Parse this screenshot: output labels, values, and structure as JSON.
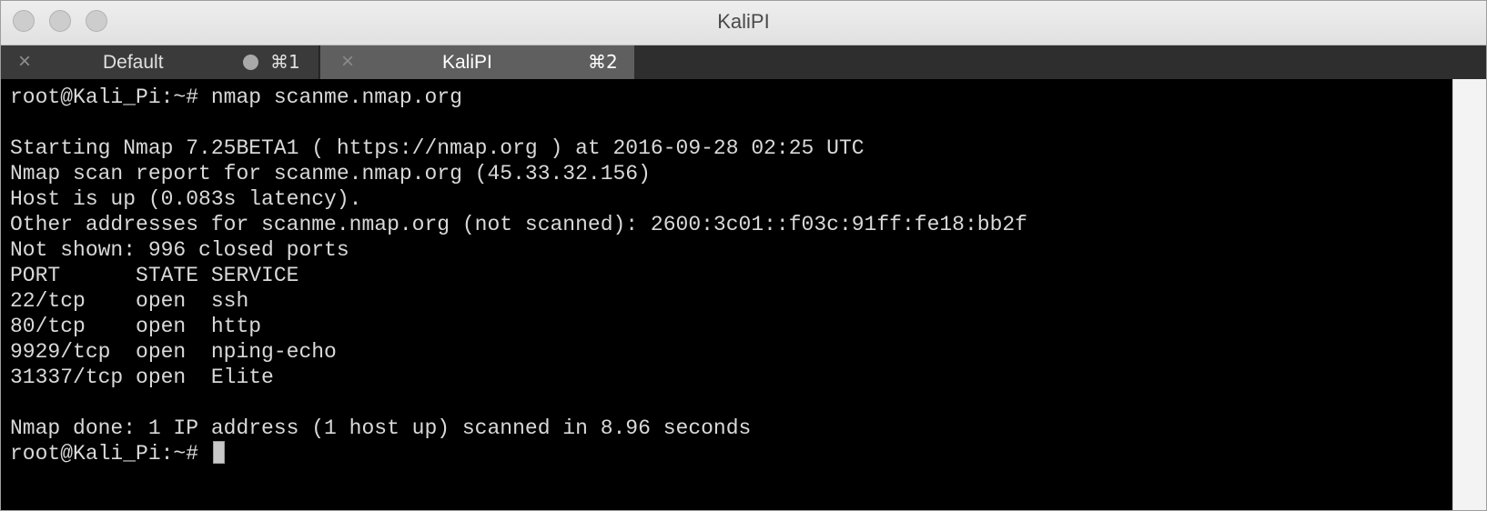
{
  "window": {
    "title": "KaliPI"
  },
  "tabs": [
    {
      "title": "Default",
      "shortcut": "⌘1",
      "active": false,
      "activity": true
    },
    {
      "title": "KaliPI",
      "shortcut": "⌘2",
      "active": true,
      "activity": false
    }
  ],
  "terminal": {
    "lines": [
      "root@Kali_Pi:~# nmap scanme.nmap.org",
      "",
      "Starting Nmap 7.25BETA1 ( https://nmap.org ) at 2016-09-28 02:25 UTC",
      "Nmap scan report for scanme.nmap.org (45.33.32.156)",
      "Host is up (0.083s latency).",
      "Other addresses for scanme.nmap.org (not scanned): 2600:3c01::f03c:91ff:fe18:bb2f",
      "Not shown: 996 closed ports",
      "PORT      STATE SERVICE",
      "22/tcp    open  ssh",
      "80/tcp    open  http",
      "9929/tcp  open  nping-echo",
      "31337/tcp open  Elite",
      "",
      "Nmap done: 1 IP address (1 host up) scanned in 8.96 seconds"
    ],
    "prompt": "root@Kali_Pi:~# "
  },
  "colors": {
    "terminal_background": "#000000",
    "terminal_foreground": "#d9d9d9",
    "tabbar_background": "#2e2e2e",
    "active_tab_background": "#5f5f5f",
    "titlebar_background": "#e6e6e6"
  }
}
